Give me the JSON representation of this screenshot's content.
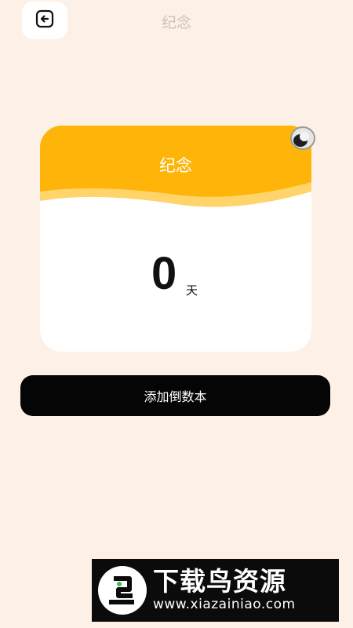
{
  "header": {
    "title": "纪念",
    "back_icon": "back-arrow-icon"
  },
  "card": {
    "title": "纪念",
    "count": "0",
    "unit": "天",
    "pin_icon": "ring-binder-icon",
    "colors": {
      "header": "#ffb40a",
      "wave": "#ffd46a",
      "body": "#ffffff"
    }
  },
  "actions": {
    "add_label": "添加倒数本"
  },
  "watermark": {
    "main_text": "下载鸟资源",
    "url_text": "www.xiazainiao.com",
    "logo_icon": "bird-logo-icon"
  },
  "colors": {
    "background": "#fdf0e7",
    "button": "#050505",
    "title_muted": "#c9c2bc"
  }
}
